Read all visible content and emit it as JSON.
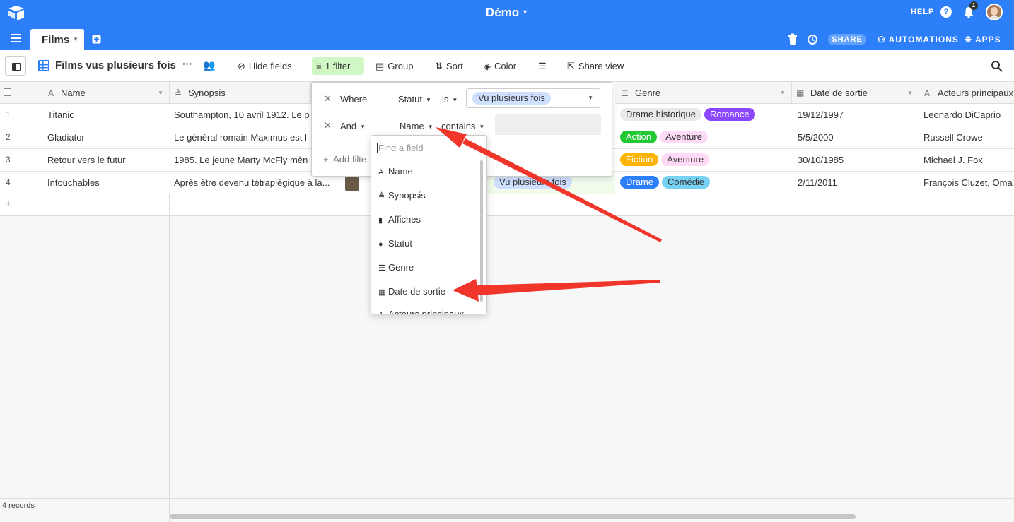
{
  "base": {
    "title": "Démo"
  },
  "topbar": {
    "help": "HELP",
    "help_icon_glyph": "?",
    "notifications_count": "1",
    "table_tab": "Films",
    "share": "SHARE",
    "automations": "AUTOMATIONS",
    "apps": "APPS",
    "brand_color": "#2d7ff9"
  },
  "viewbar": {
    "view_name": "Films vus plusieurs fois",
    "more": "···",
    "hide_fields": "Hide fields",
    "filter": "1 filter",
    "group": "Group",
    "sort": "Sort",
    "color": "Color",
    "share_view": "Share view"
  },
  "columns": [
    {
      "label": "Name",
      "icon": "text-icon"
    },
    {
      "label": "Synopsis",
      "icon": "long-text-icon"
    },
    {
      "label": "Genre",
      "icon": "multi-select-icon"
    },
    {
      "label": "Date de sortie",
      "icon": "date-icon"
    },
    {
      "label": "Acteurs principaux",
      "icon": "text-icon"
    }
  ],
  "rows": [
    {
      "num": "1",
      "name": "Titanic",
      "synopsis": "Southampton, 10 avril 1912. Le p",
      "genres": [
        {
          "label": "Drame historique",
          "bg": "#e9e9e9",
          "fg": "#333"
        },
        {
          "label": "Romance",
          "bg": "#8b46ff",
          "fg": "#fff"
        }
      ],
      "date": "19/12/1997",
      "actors": "Leonardo DiCaprio"
    },
    {
      "num": "2",
      "name": "Gladiator",
      "synopsis": "Le général romain Maximus est l",
      "genres": [
        {
          "label": "Action",
          "bg": "#20c933",
          "fg": "#fff"
        },
        {
          "label": "Aventure",
          "bg": "#ffdaf6",
          "fg": "#333"
        }
      ],
      "date": "5/5/2000",
      "actors": "Russell Crowe"
    },
    {
      "num": "3",
      "name": "Retour vers le futur",
      "synopsis": "1985. Le jeune Marty McFly mèn",
      "genres": [
        {
          "label": "Fiction",
          "bg": "#fcb400",
          "fg": "#fff"
        },
        {
          "label": "Aventure",
          "bg": "#ffdaf6",
          "fg": "#333"
        }
      ],
      "date": "30/10/1985",
      "actors": "Michael J. Fox"
    },
    {
      "num": "4",
      "name": "Intouchables",
      "synopsis": "Après être devenu tétraplégique à la...",
      "status": "Vu plusieurs fois",
      "genres": [
        {
          "label": "Drame",
          "bg": "#2d7ff9",
          "fg": "#fff"
        },
        {
          "label": "Comédie",
          "bg": "#77d1f3",
          "fg": "#333"
        }
      ],
      "date": "2/11/2011",
      "actors": "François Cluzet, Oma"
    }
  ],
  "add_row": "+",
  "footer": {
    "records": "4 records"
  },
  "filter_popover": {
    "where": "Where",
    "field1": "Statut",
    "op1": "is",
    "value1": "Vu plusieurs fois",
    "and": "And",
    "field2": "Name",
    "op2": "contains",
    "add_filter": "Add filte"
  },
  "field_dropdown": {
    "placeholder": "Find a field",
    "items": [
      {
        "label": "Name",
        "icon": "A"
      },
      {
        "label": "Synopsis",
        "icon": "≜"
      },
      {
        "label": "Affiches",
        "icon": "▮"
      },
      {
        "label": "Statut",
        "icon": "●"
      },
      {
        "label": "Genre",
        "icon": "☰"
      },
      {
        "label": "Date de sortie",
        "icon": "▦"
      },
      {
        "label": "Acteurs principaux",
        "icon": "A"
      }
    ]
  },
  "annotation": {
    "arrow_color": "#f0362b"
  }
}
